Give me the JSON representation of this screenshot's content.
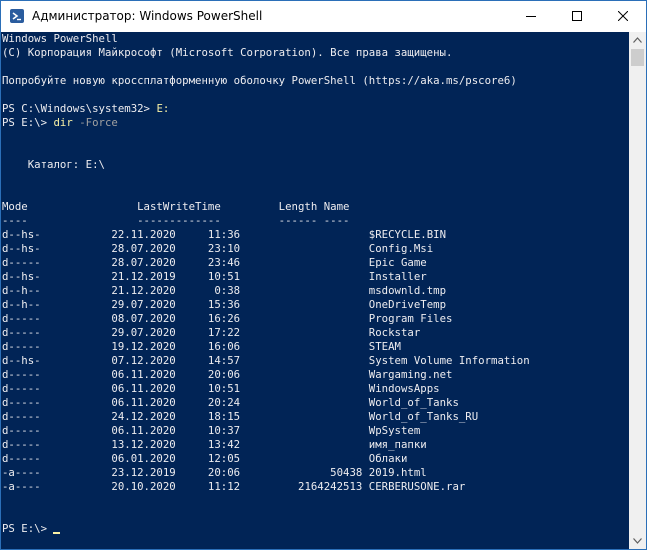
{
  "window": {
    "title": "Администратор: Windows PowerShell",
    "icon": "powershell-icon",
    "controls": [
      "minimize-icon",
      "maximize-icon",
      "close-icon"
    ]
  },
  "colors": {
    "console_bg": "#012456",
    "console_fg": "#eeedf0",
    "command": "#f9f1a5",
    "parameter": "#a0a0a0"
  },
  "console": {
    "banner": [
      "Windows PowerShell",
      "(C) Корпорация Майкрософт (Microsoft Corporation). Все права защищены.",
      "Попробуйте новую кроссплатформенную оболочку PowerShell (https://aka.ms/pscore6)"
    ],
    "cmd1": {
      "prompt": "PS C:\\Windows\\system32> ",
      "command": "E:"
    },
    "cmd2": {
      "prompt": "PS E:\\> ",
      "command": "dir",
      "param": " -Force"
    },
    "catalog": "    Каталог: E:\\",
    "header": "Mode                 LastWriteTime         Length Name",
    "separator": "----                 -------------         ------ ----",
    "rows": [
      {
        "mode": "d--hs-",
        "date": "22.11.2020",
        "time": "11:36",
        "length": "",
        "name": "$RECYCLE.BIN"
      },
      {
        "mode": "d--hs-",
        "date": "28.07.2020",
        "time": "23:10",
        "length": "",
        "name": "Config.Msi"
      },
      {
        "mode": "d-----",
        "date": "28.07.2020",
        "time": "23:46",
        "length": "",
        "name": "Epic Game"
      },
      {
        "mode": "d--hs-",
        "date": "21.12.2019",
        "time": "10:51",
        "length": "",
        "name": "Installer"
      },
      {
        "mode": "d--h--",
        "date": "21.12.2020",
        "time": "0:38",
        "length": "",
        "name": "msdownld.tmp"
      },
      {
        "mode": "d--h--",
        "date": "29.07.2020",
        "time": "15:36",
        "length": "",
        "name": "OneDriveTemp"
      },
      {
        "mode": "d-----",
        "date": "08.07.2020",
        "time": "16:26",
        "length": "",
        "name": "Program Files"
      },
      {
        "mode": "d-----",
        "date": "29.07.2020",
        "time": "17:22",
        "length": "",
        "name": "Rockstar"
      },
      {
        "mode": "d-----",
        "date": "19.12.2020",
        "time": "16:06",
        "length": "",
        "name": "STEAM"
      },
      {
        "mode": "d--hs-",
        "date": "07.12.2020",
        "time": "14:57",
        "length": "",
        "name": "System Volume Information"
      },
      {
        "mode": "d-----",
        "date": "06.11.2020",
        "time": "20:06",
        "length": "",
        "name": "Wargaming.net"
      },
      {
        "mode": "d-----",
        "date": "06.11.2020",
        "time": "10:51",
        "length": "",
        "name": "WindowsApps"
      },
      {
        "mode": "d-----",
        "date": "06.11.2020",
        "time": "20:24",
        "length": "",
        "name": "World_of_Tanks"
      },
      {
        "mode": "d-----",
        "date": "24.12.2020",
        "time": "18:15",
        "length": "",
        "name": "World_of_Tanks_RU"
      },
      {
        "mode": "d-----",
        "date": "06.11.2020",
        "time": "10:37",
        "length": "",
        "name": "WpSystem"
      },
      {
        "mode": "d-----",
        "date": "13.12.2020",
        "time": "13:42",
        "length": "",
        "name": "имя_папки"
      },
      {
        "mode": "d-----",
        "date": "06.01.2020",
        "time": "12:05",
        "length": "",
        "name": "Облаки"
      },
      {
        "mode": "-a----",
        "date": "23.12.2019",
        "time": "20:06",
        "length": "50438",
        "name": "2019.html"
      },
      {
        "mode": "-a----",
        "date": "20.10.2020",
        "time": "11:12",
        "length": "2164242513",
        "name": "CERBERUSONE.rar"
      }
    ],
    "final_prompt": "PS E:\\> "
  }
}
